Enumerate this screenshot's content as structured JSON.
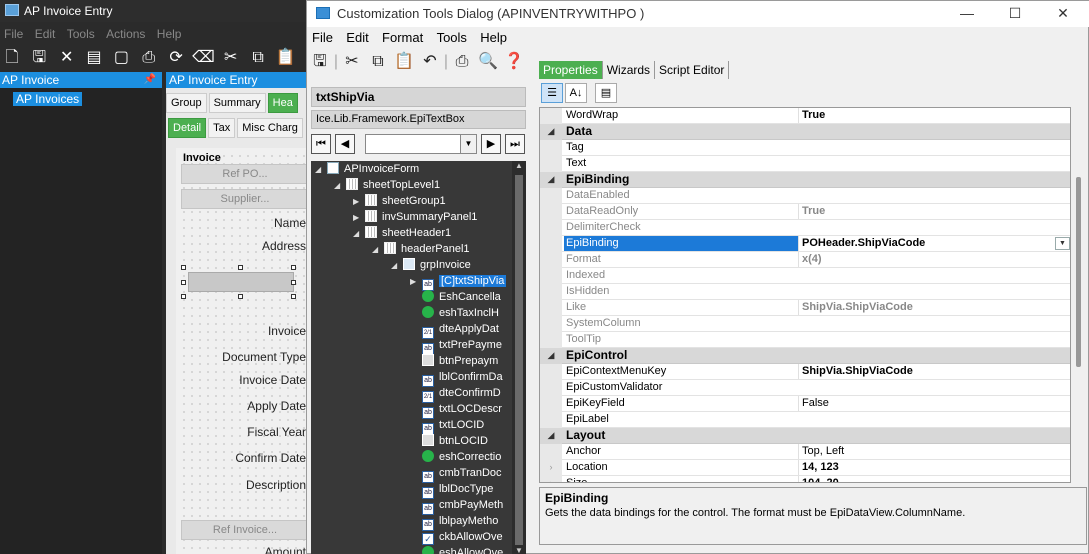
{
  "bg_app": {
    "title": "AP Invoice Entry",
    "menu": [
      "File",
      "Edit",
      "Tools",
      "Actions",
      "Help"
    ],
    "left_panel_title": "AP Invoice",
    "left_panel_item": "AP Invoices",
    "main_title": "AP Invoice Entry",
    "tabs_row1": [
      "Group",
      "Summary",
      "Hea"
    ],
    "tabs_row2": [
      "Detail",
      "Tax",
      "Misc Charg"
    ],
    "group_title": "Invoice",
    "buttons": {
      "ref_po": "Ref PO...",
      "supplier": "Supplier...",
      "ref_invoice": "Ref Invoice..."
    },
    "labels": [
      "Name",
      "Address",
      "Invoice",
      "Document Type",
      "Invoice Date",
      "Apply Date",
      "Fiscal Year",
      "Confirm Date",
      "Description",
      "Amount"
    ]
  },
  "dialog": {
    "title": "Customization Tools Dialog  (APINVENTRYWITHPO )",
    "menu": [
      "File",
      "Edit",
      "Format",
      "Tools",
      "Help"
    ],
    "control_name": "txtShipVia",
    "control_type": "Ice.Lib.Framework.EpiTextBox",
    "tabs": [
      "Properties",
      "Wizards",
      "Script Editor"
    ],
    "tree": [
      {
        "label": "APInvoiceForm",
        "indent": 0,
        "tri": "down",
        "icon": "form"
      },
      {
        "label": "sheetTopLevel1",
        "indent": 1,
        "tri": "down",
        "icon": "sheet"
      },
      {
        "label": "sheetGroup1",
        "indent": 2,
        "tri": "right",
        "icon": "sheet"
      },
      {
        "label": "invSummaryPanel1",
        "indent": 2,
        "tri": "right",
        "icon": "sheet"
      },
      {
        "label": "sheetHeader1",
        "indent": 2,
        "tri": "down",
        "icon": "sheet"
      },
      {
        "label": "headerPanel1",
        "indent": 3,
        "tri": "down",
        "icon": "sheet"
      },
      {
        "label": "grpInvoice",
        "indent": 4,
        "tri": "down",
        "icon": "group"
      },
      {
        "label": "[C]txtShipVia",
        "indent": 5,
        "tri": "right",
        "icon": "text",
        "selected": true
      },
      {
        "label": "EshCancella",
        "indent": 5,
        "tri": "",
        "icon": "green"
      },
      {
        "label": "eshTaxInclH",
        "indent": 5,
        "tri": "",
        "icon": "green"
      },
      {
        "label": "dteApplyDat",
        "indent": 5,
        "tri": "",
        "icon": "date"
      },
      {
        "label": "txtPrePayme",
        "indent": 5,
        "tri": "",
        "icon": "text"
      },
      {
        "label": "btnPrepaym",
        "indent": 5,
        "tri": "",
        "icon": "btn"
      },
      {
        "label": "lblConfirmDa",
        "indent": 5,
        "tri": "",
        "icon": "text"
      },
      {
        "label": "dteConfirmD",
        "indent": 5,
        "tri": "",
        "icon": "date"
      },
      {
        "label": "txtLOCDescr",
        "indent": 5,
        "tri": "",
        "icon": "text"
      },
      {
        "label": "txtLOCID",
        "indent": 5,
        "tri": "",
        "icon": "text"
      },
      {
        "label": "btnLOCID",
        "indent": 5,
        "tri": "",
        "icon": "btn"
      },
      {
        "label": "eshCorrectio",
        "indent": 5,
        "tri": "",
        "icon": "green"
      },
      {
        "label": "cmbTranDoc",
        "indent": 5,
        "tri": "",
        "icon": "text"
      },
      {
        "label": "lblDocType",
        "indent": 5,
        "tri": "",
        "icon": "text"
      },
      {
        "label": "cmbPayMeth",
        "indent": 5,
        "tri": "",
        "icon": "text"
      },
      {
        "label": "lblpayMetho",
        "indent": 5,
        "tri": "",
        "icon": "text"
      },
      {
        "label": "ckbAllowOve",
        "indent": 5,
        "tri": "",
        "icon": "check"
      },
      {
        "label": "eshAllowOve",
        "indent": 5,
        "tri": "",
        "icon": "green"
      }
    ],
    "properties": [
      {
        "name": "WordWrap",
        "value": "True",
        "bold": true
      },
      {
        "name": "Data",
        "category": true
      },
      {
        "name": "Tag",
        "value": ""
      },
      {
        "name": "Text",
        "value": ""
      },
      {
        "name": "EpiBinding",
        "category": true
      },
      {
        "name": "DataEnabled",
        "value": "",
        "disabled": true
      },
      {
        "name": "DataReadOnly",
        "value": "True",
        "disabled": true,
        "bold": true
      },
      {
        "name": "DelimiterCheck",
        "value": "",
        "disabled": true
      },
      {
        "name": "EpiBinding",
        "value": "POHeader.ShipViaCode",
        "selected": true,
        "bold": true
      },
      {
        "name": "Format",
        "value": "x(4)",
        "disabled": true,
        "bold": true
      },
      {
        "name": "Indexed",
        "value": "",
        "disabled": true
      },
      {
        "name": "IsHidden",
        "value": "",
        "disabled": true
      },
      {
        "name": "Like",
        "value": "ShipVia.ShipViaCode",
        "disabled": true,
        "bold": true
      },
      {
        "name": "SystemColumn",
        "value": "",
        "disabled": true
      },
      {
        "name": "ToolTip",
        "value": "",
        "disabled": true
      },
      {
        "name": "EpiControl",
        "category": true
      },
      {
        "name": "EpiContextMenuKey",
        "value": "ShipVia.ShipViaCode",
        "bold": true
      },
      {
        "name": "EpiCustomValidator",
        "value": ""
      },
      {
        "name": "EpiKeyField",
        "value": "False"
      },
      {
        "name": "EpiLabel",
        "value": ""
      },
      {
        "name": "Layout",
        "category": true
      },
      {
        "name": "Anchor",
        "value": "Top, Left"
      },
      {
        "name": "Location",
        "value": "14, 123",
        "bold": true,
        "expandable": true
      },
      {
        "name": "Size",
        "value": "104, 20",
        "bold": true,
        "expandable": true
      }
    ],
    "description": {
      "title": "EpiBinding",
      "text": "Gets the data bindings for the control. The format must be EpiDataView.ColumnName."
    }
  }
}
